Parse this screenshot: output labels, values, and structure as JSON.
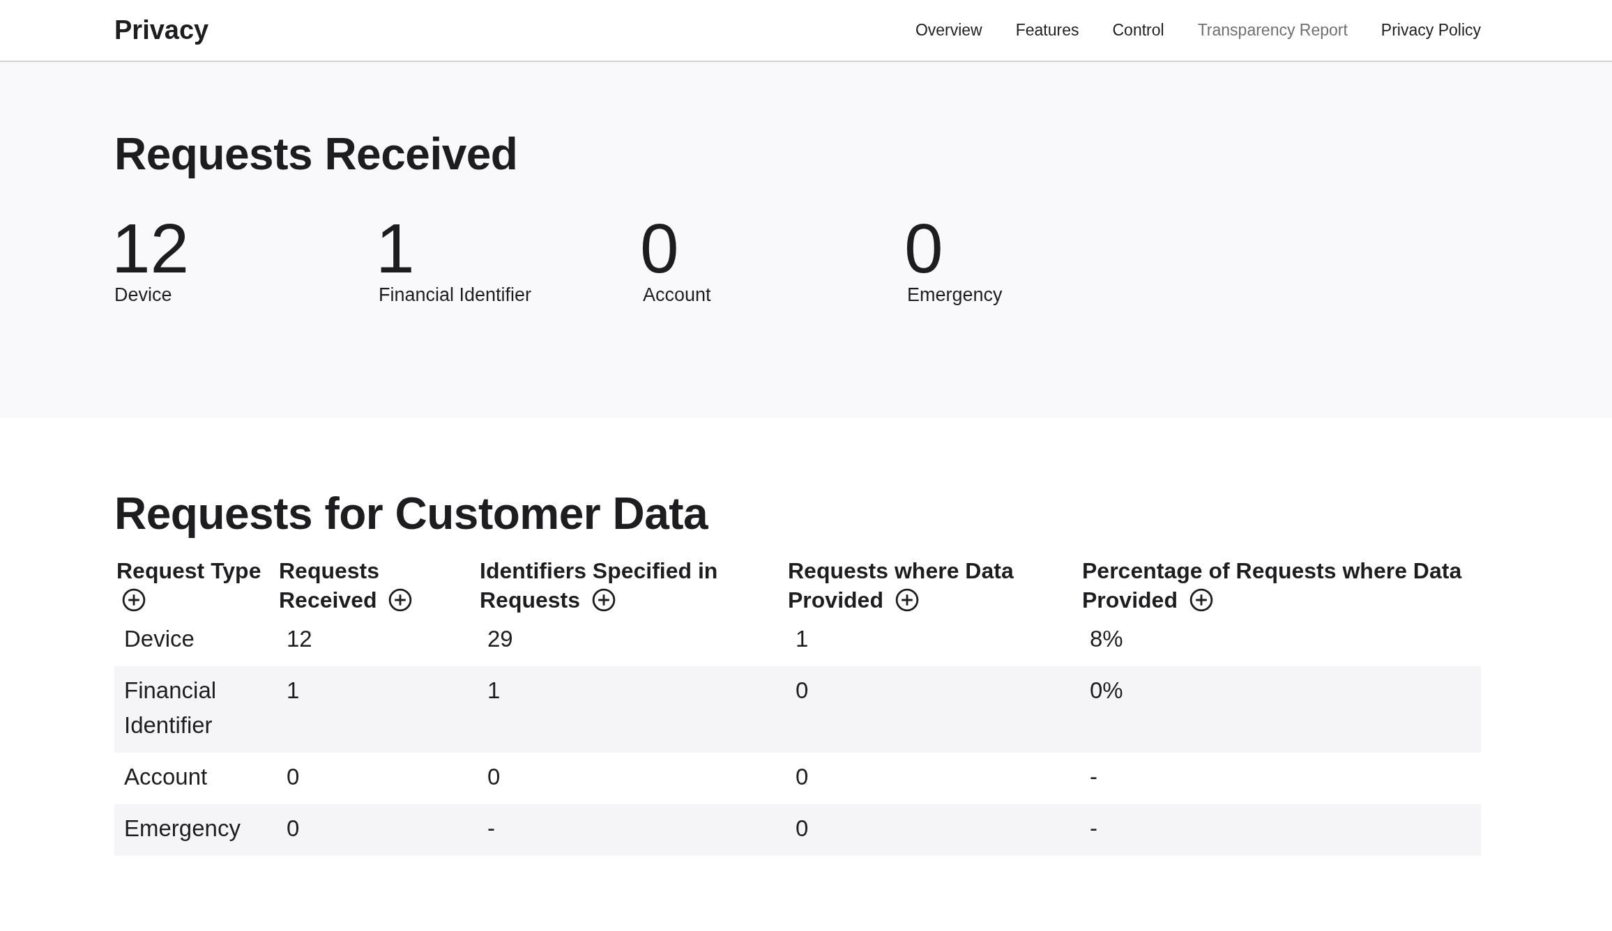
{
  "nav": {
    "brand": "Privacy",
    "links": [
      {
        "label": "Overview",
        "selected": false
      },
      {
        "label": "Features",
        "selected": false
      },
      {
        "label": "Control",
        "selected": false
      },
      {
        "label": "Transparency Report",
        "selected": true
      },
      {
        "label": "Privacy Policy",
        "selected": false
      }
    ]
  },
  "summary": {
    "title": "Requests Received",
    "stats": [
      {
        "value": "12",
        "label": "Device"
      },
      {
        "value": "1",
        "label": "Financial Identifier"
      },
      {
        "value": "0",
        "label": "Account"
      },
      {
        "value": "0",
        "label": "Emergency"
      }
    ]
  },
  "table": {
    "title": "Requests for Customer Data",
    "columns": [
      {
        "label": "Request Type",
        "expandable": true
      },
      {
        "label": "Requests Received",
        "expandable": true
      },
      {
        "label": "Identifiers Specified in Requests",
        "expandable": true
      },
      {
        "label": "Requests where Data Provided",
        "expandable": true
      },
      {
        "label": "Percentage of Requests where Data Provided",
        "expandable": true
      }
    ],
    "rows": [
      [
        "Device",
        "12",
        "29",
        "1",
        "8%"
      ],
      [
        "Financial Identifier",
        "1",
        "1",
        "0",
        "0%"
      ],
      [
        "Account",
        "0",
        "0",
        "0",
        "-"
      ],
      [
        "Emergency",
        "0",
        "-",
        "0",
        "-"
      ]
    ]
  }
}
